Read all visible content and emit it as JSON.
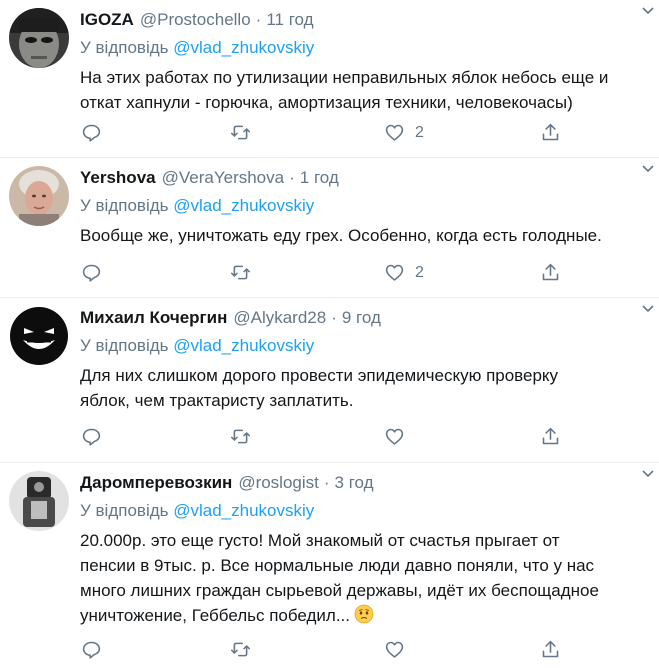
{
  "tweets": [
    {
      "name": "IGOZA",
      "handle": "@Prostochello",
      "dot": "·",
      "time": "11 год",
      "reply_prefix": "У відповідь",
      "reply_to": "@vlad_zhukovskiy",
      "text_lines": [
        "На этих работах по утилизации неправильных яблок небось еще и",
        "откат хапнули - горючка, амортизация техники, человекочасы)"
      ],
      "likes": "2"
    },
    {
      "name": "Yershova",
      "handle": "@VeraYershova",
      "dot": "·",
      "time": "1 год",
      "reply_prefix": "У відповідь",
      "reply_to": "@vlad_zhukovskiy",
      "text_lines": [
        "Вообще же, уничтожать еду грех. Особенно, когда есть голодные."
      ],
      "likes": "2"
    },
    {
      "name": "Михаил Кочергин",
      "handle": "@Alykard28",
      "dot": "·",
      "time": "9 год",
      "reply_prefix": "У відповідь",
      "reply_to": "@vlad_zhukovskiy",
      "text_lines": [
        "Для них слишком дорого провести эпидемическую проверку",
        "яблок, чем трактаристу заплатить."
      ],
      "likes": ""
    },
    {
      "name": "Даромперевозкин",
      "handle": "@roslogist",
      "dot": "·",
      "time": "3 год",
      "reply_prefix": "У відповідь",
      "reply_to": "@vlad_zhukovskiy",
      "text_lines": [
        "20.000р. это еще густо! Мой знакомый от счастья прыгает от",
        "пенсии в 9тыс. р. Все нормальные люди давно поняли, что у нас",
        "много лишних граждан сырьевой державы, идёт их беспощадное",
        "уничтожение, Геббельс победил..."
      ],
      "likes": "",
      "emoji": "worried-face-icon"
    }
  ],
  "colors": {
    "accent": "#1da1f2",
    "muted": "#657786",
    "text": "#14171a",
    "divider": "#e6ecf0"
  },
  "icons": [
    "reply-icon",
    "retweet-icon",
    "like-icon",
    "share-icon",
    "chevron-down-icon"
  ]
}
